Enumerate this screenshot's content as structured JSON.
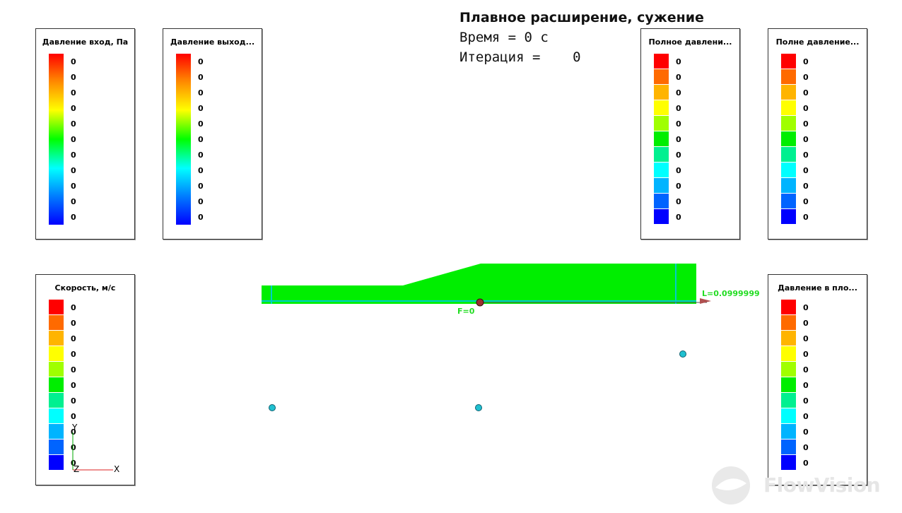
{
  "title": {
    "main": "Плавное расширение, сужение",
    "time_line": "Время = 0 с",
    "iteration_line": "Итерация =    0"
  },
  "legends": [
    {
      "name": "legend-inlet-pressure",
      "title": "Давление вход, Па",
      "style": "gradient",
      "ticks": [
        "0",
        "0",
        "0",
        "0",
        "0",
        "0",
        "0",
        "0",
        "0",
        "0",
        "0"
      ]
    },
    {
      "name": "legend-outlet-pressure",
      "title": "Давление выход...",
      "style": "gradient",
      "ticks": [
        "0",
        "0",
        "0",
        "0",
        "0",
        "0",
        "0",
        "0",
        "0",
        "0",
        "0"
      ]
    },
    {
      "name": "legend-total-pressure-1",
      "title": "Полное давлени...",
      "style": "discrete",
      "ticks": [
        "0",
        "0",
        "0",
        "0",
        "0",
        "0",
        "0",
        "0",
        "0",
        "0",
        "0"
      ]
    },
    {
      "name": "legend-total-pressure-2",
      "title": "Полне давление...",
      "style": "discrete",
      "ticks": [
        "0",
        "0",
        "0",
        "0",
        "0",
        "0",
        "0",
        "0",
        "0",
        "0",
        "0"
      ]
    },
    {
      "name": "legend-velocity",
      "title": "Скорость, м/с",
      "style": "discrete",
      "ticks": [
        "0",
        "0",
        "0",
        "0",
        "0",
        "0",
        "0",
        "0",
        "0",
        "0",
        "0"
      ]
    },
    {
      "name": "legend-plane-pressure",
      "title": "Давление в пло...",
      "style": "discrete",
      "ticks": [
        "0",
        "0",
        "0",
        "0",
        "0",
        "0",
        "0",
        "0",
        "0",
        "0",
        "0"
      ]
    }
  ],
  "discrete_colors": [
    "#ff0000",
    "#ff6a00",
    "#ffb400",
    "#ffff00",
    "#a0ff00",
    "#00ee00",
    "#00f090",
    "#00ffff",
    "#00b4ff",
    "#0064ff",
    "#0000ff"
  ],
  "geometry_labels": {
    "f_label": "F=0",
    "l_label": "L=0.0999999"
  },
  "axes": {
    "y": "Y",
    "z": "Z",
    "x": "X"
  },
  "watermark": "FlowVision",
  "colors": {
    "domain_fill": "#00ee00",
    "domain_edge": "#00cccc",
    "marker": "#20c0d0"
  }
}
